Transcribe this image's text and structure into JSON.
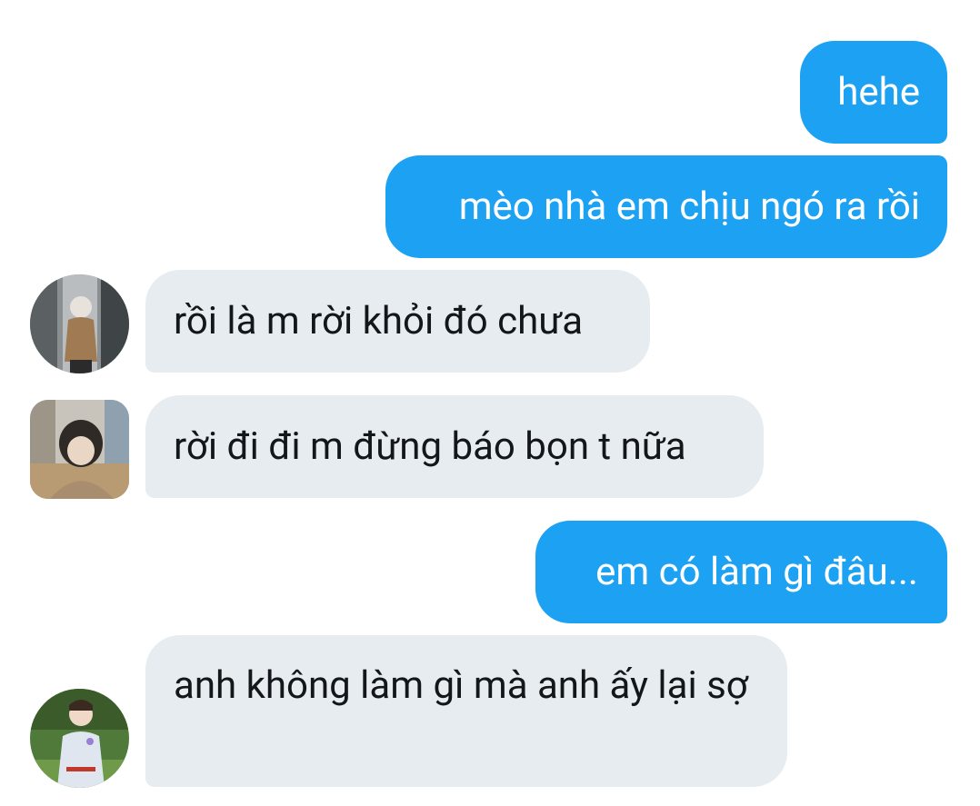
{
  "messages": [
    {
      "direction": "outgoing",
      "text": "hehe"
    },
    {
      "direction": "outgoing",
      "text": "mèo nhà em chịu ngó ra rồi"
    },
    {
      "direction": "incoming",
      "text": "rồi là m rời khỏi đó chưa",
      "avatar": "user-avatar-icon"
    },
    {
      "direction": "incoming",
      "text": "rời đi đi m đừng báo bọn t nữa",
      "avatar": "user-avatar-icon"
    },
    {
      "direction": "outgoing",
      "text": "em có làm gì đâu..."
    },
    {
      "direction": "incoming",
      "text": "anh không làm gì mà anh ấy lại sợ",
      "avatar": "user-avatar-icon"
    }
  ],
  "colors": {
    "outgoing_bubble": "#1da1f2",
    "incoming_bubble": "#e6ecf0",
    "outgoing_text": "#ffffff",
    "incoming_text": "#14171a",
    "background": "#ffffff"
  }
}
